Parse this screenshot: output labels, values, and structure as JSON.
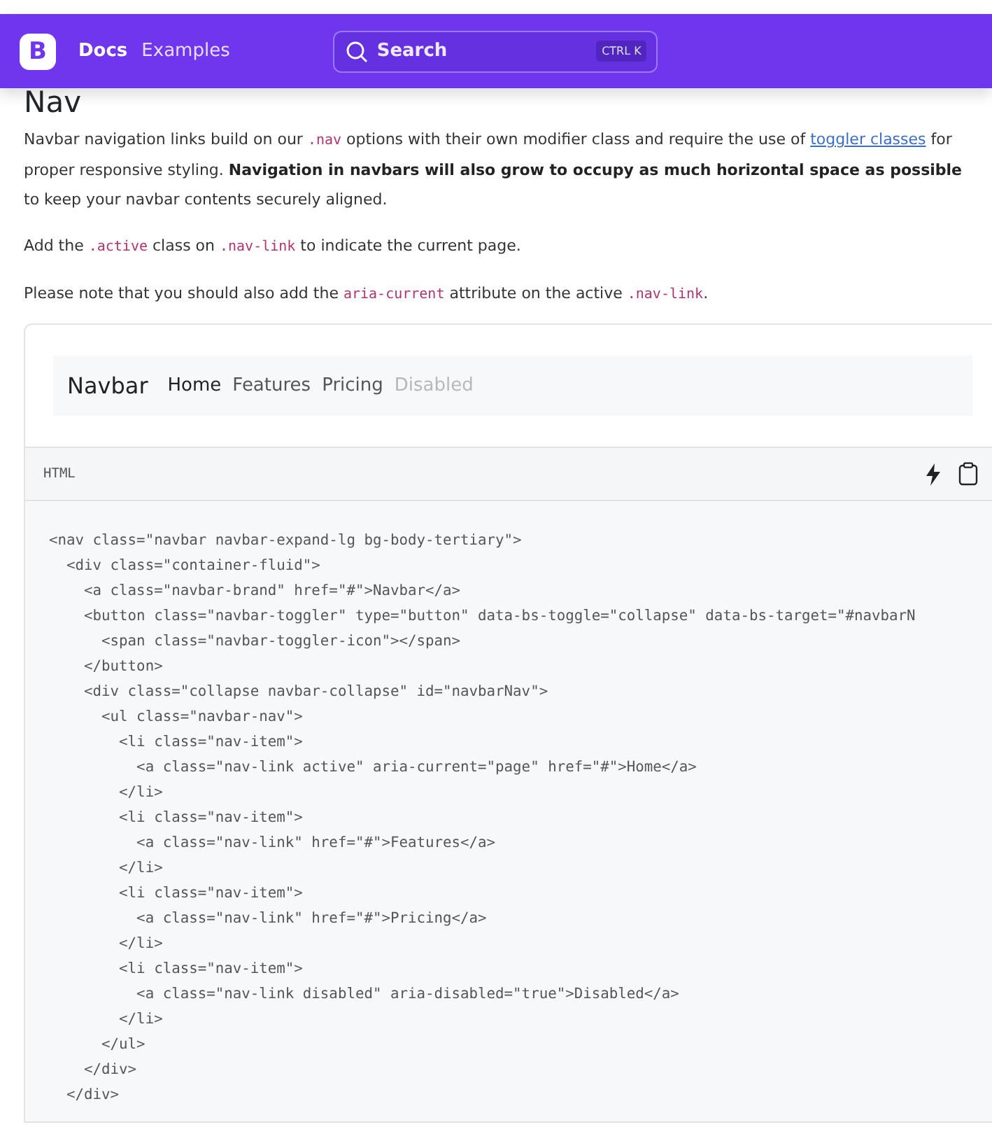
{
  "topbar": {
    "brand": "B",
    "links": [
      {
        "label": "Docs",
        "selected": true
      },
      {
        "label": "Examples",
        "selected": false
      }
    ],
    "search": {
      "placeholder": "Search",
      "shortcut": "CTRL K"
    }
  },
  "heading": "Nav",
  "paragraphs": [
    [
      {
        "kind": "text",
        "text": "Navbar navigation links build on our "
      },
      {
        "kind": "code",
        "text": ".nav"
      },
      {
        "kind": "text",
        "text": " options with their own modifier class and require the use of "
      },
      {
        "kind": "link",
        "text": "toggler classes"
      },
      {
        "kind": "text",
        "text": " for proper responsive styling. "
      },
      {
        "kind": "bold",
        "text": "Navigation in navbars will also grow to occupy as much horizontal space as possible"
      },
      {
        "kind": "text",
        "text": " to keep your navbar contents securely aligned."
      }
    ],
    [
      {
        "kind": "text",
        "text": "Add the "
      },
      {
        "kind": "code",
        "text": ".active"
      },
      {
        "kind": "text",
        "text": " class on "
      },
      {
        "kind": "code",
        "text": ".nav-link"
      },
      {
        "kind": "text",
        "text": " to indicate the current page."
      }
    ],
    [
      {
        "kind": "text",
        "text": "Please note that you should also add the "
      },
      {
        "kind": "code",
        "text": "aria-current"
      },
      {
        "kind": "text",
        "text": " attribute on the active "
      },
      {
        "kind": "code",
        "text": ".nav-link"
      },
      {
        "kind": "text",
        "text": "."
      }
    ]
  ],
  "example": {
    "brand": "Navbar",
    "links": [
      {
        "label": "Home",
        "selected": true,
        "disabled": false
      },
      {
        "label": "Features",
        "selected": false,
        "disabled": false
      },
      {
        "label": "Pricing",
        "selected": false,
        "disabled": false
      },
      {
        "label": "Disabled",
        "selected": false,
        "disabled": true
      }
    ]
  },
  "code_header": {
    "language": "HTML"
  },
  "code_lines": [
    "<nav class=\"navbar navbar-expand-lg bg-body-tertiary\">",
    "  <div class=\"container-fluid\">",
    "    <a class=\"navbar-brand\" href=\"#\">Navbar</a>",
    "    <button class=\"navbar-toggler\" type=\"button\" data-bs-toggle=\"collapse\" data-bs-target=\"#navbarN",
    "      <span class=\"navbar-toggler-icon\"></span>",
    "    </button>",
    "    <div class=\"collapse navbar-collapse\" id=\"navbarNav\">",
    "      <ul class=\"navbar-nav\">",
    "        <li class=\"nav-item\">",
    "          <a class=\"nav-link active\" aria-current=\"page\" href=\"#\">Home</a>",
    "        </li>",
    "        <li class=\"nav-item\">",
    "          <a class=\"nav-link\" href=\"#\">Features</a>",
    "        </li>",
    "        <li class=\"nav-item\">",
    "          <a class=\"nav-link\" href=\"#\">Pricing</a>",
    "        </li>",
    "        <li class=\"nav-item\">",
    "          <a class=\"nav-link disabled\" aria-disabled=\"true\">Disabled</a>",
    "        </li>",
    "      </ul>",
    "    </div>",
    "  </div>"
  ]
}
